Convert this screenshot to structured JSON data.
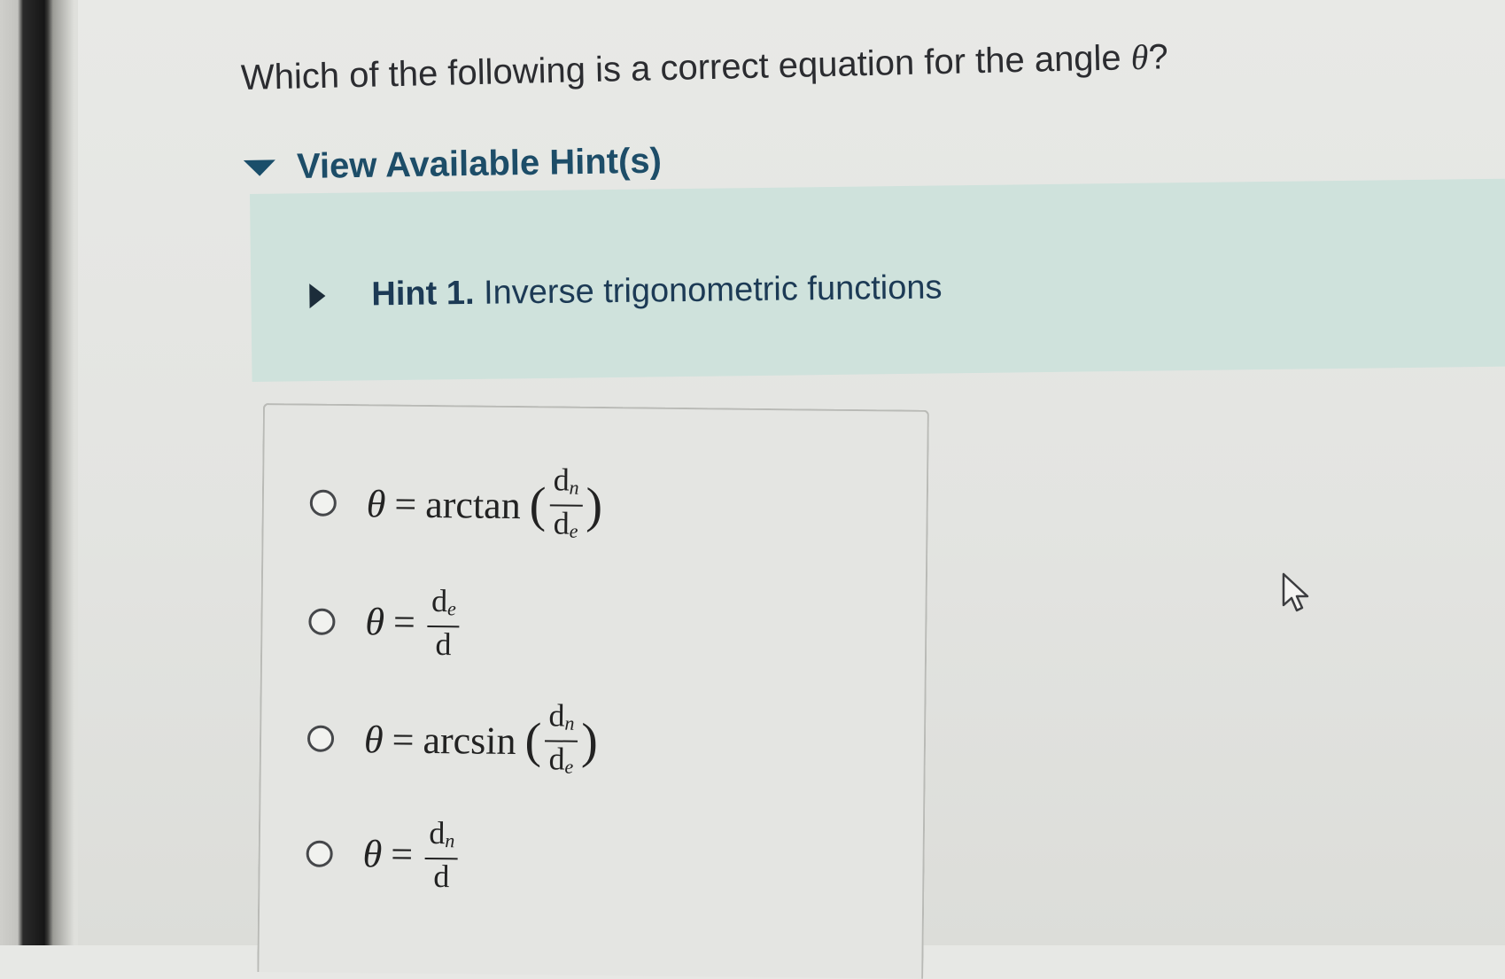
{
  "question": {
    "text_before": "Which of the following is a correct equation for the angle ",
    "variable": "θ",
    "text_after": "?"
  },
  "hints": {
    "toggle_label": "View Available Hint(s)",
    "items": [
      {
        "number": "Hint 1.",
        "title": "Inverse trigonometric functions"
      }
    ]
  },
  "options": [
    {
      "lhs": "θ",
      "eq": "=",
      "fn": "arctan",
      "numerator": "d",
      "num_sub": "n",
      "denominator": "d",
      "den_sub": "e"
    },
    {
      "lhs": "θ",
      "eq": "=",
      "fn": "",
      "numerator": "d",
      "num_sub": "e",
      "denominator": "d",
      "den_sub": ""
    },
    {
      "lhs": "θ",
      "eq": "=",
      "fn": "arcsin",
      "numerator": "d",
      "num_sub": "n",
      "denominator": "d",
      "den_sub": "e"
    },
    {
      "lhs": "θ",
      "eq": "=",
      "fn": "",
      "numerator": "d",
      "num_sub": "n",
      "denominator": "d",
      "den_sub": ""
    }
  ],
  "icons": {
    "hints_toggle": "caret-down-icon",
    "hint_item": "caret-right-icon",
    "pointer": "mouse-pointer-icon"
  },
  "colors": {
    "hint_label": "#1d4d68",
    "hint_panel": "#cfe2dc"
  }
}
